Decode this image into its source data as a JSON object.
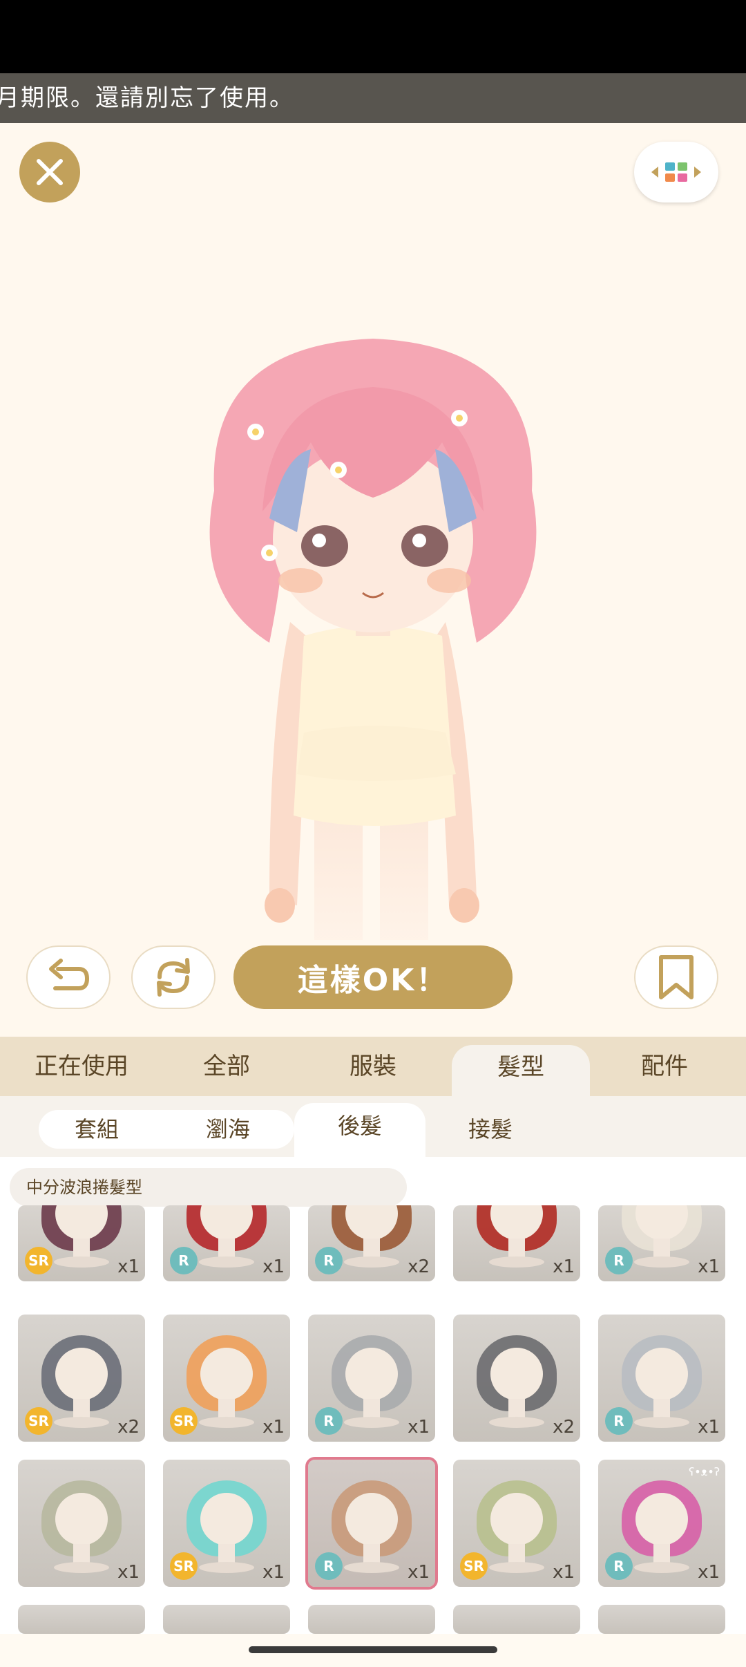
{
  "banner": {
    "text": "月期限。還請別忘了使用。"
  },
  "buttons": {
    "ok_label": "這樣OK！"
  },
  "tabs": [
    {
      "label": "正在使用"
    },
    {
      "label": "全部"
    },
    {
      "label": "服裝"
    },
    {
      "label": "髮型",
      "active": true
    },
    {
      "label": "配件"
    }
  ],
  "subtabs": [
    {
      "label": "套組"
    },
    {
      "label": "瀏海"
    },
    {
      "label": "後髮",
      "active": true
    },
    {
      "label": "接髮"
    }
  ],
  "item_title": "中分波浪捲髮型",
  "items": [
    {
      "rarity": "SR",
      "count": "x1",
      "hair_color": "#6b3a4a"
    },
    {
      "rarity": "R",
      "count": "x1",
      "hair_color": "#b5272a"
    },
    {
      "rarity": "R",
      "count": "x2",
      "hair_color": "#9a5a36"
    },
    {
      "rarity": "",
      "count": "x1",
      "hair_color": "#b02a22"
    },
    {
      "rarity": "R",
      "count": "x1",
      "hair_color": "#e9e2d6"
    },
    {
      "rarity": "SR",
      "count": "x2",
      "hair_color": "#6a6e78"
    },
    {
      "rarity": "SR",
      "count": "x1",
      "hair_color": "#f0a05a"
    },
    {
      "rarity": "R",
      "count": "x1",
      "hair_color": "#a9abad"
    },
    {
      "rarity": "",
      "count": "x2",
      "hair_color": "#6b6b6f"
    },
    {
      "rarity": "R",
      "count": "x1",
      "hair_color": "#b8bcc2"
    },
    {
      "rarity": "",
      "count": "x1",
      "hair_color": "#b7b89e"
    },
    {
      "rarity": "SR",
      "count": "x1",
      "hair_color": "#72d6cf"
    },
    {
      "rarity": "R",
      "count": "x1",
      "hair_color": "#c99a7a",
      "selected": true
    },
    {
      "rarity": "SR",
      "count": "x1",
      "hair_color": "#b8c08e"
    },
    {
      "rarity": "R",
      "count": "x1",
      "hair_color": "#d75fa7"
    }
  ],
  "colors": {
    "gold": "#c2a15b",
    "tab_bar": "#ecdfc8",
    "selected_outline": "#e07a8e"
  }
}
